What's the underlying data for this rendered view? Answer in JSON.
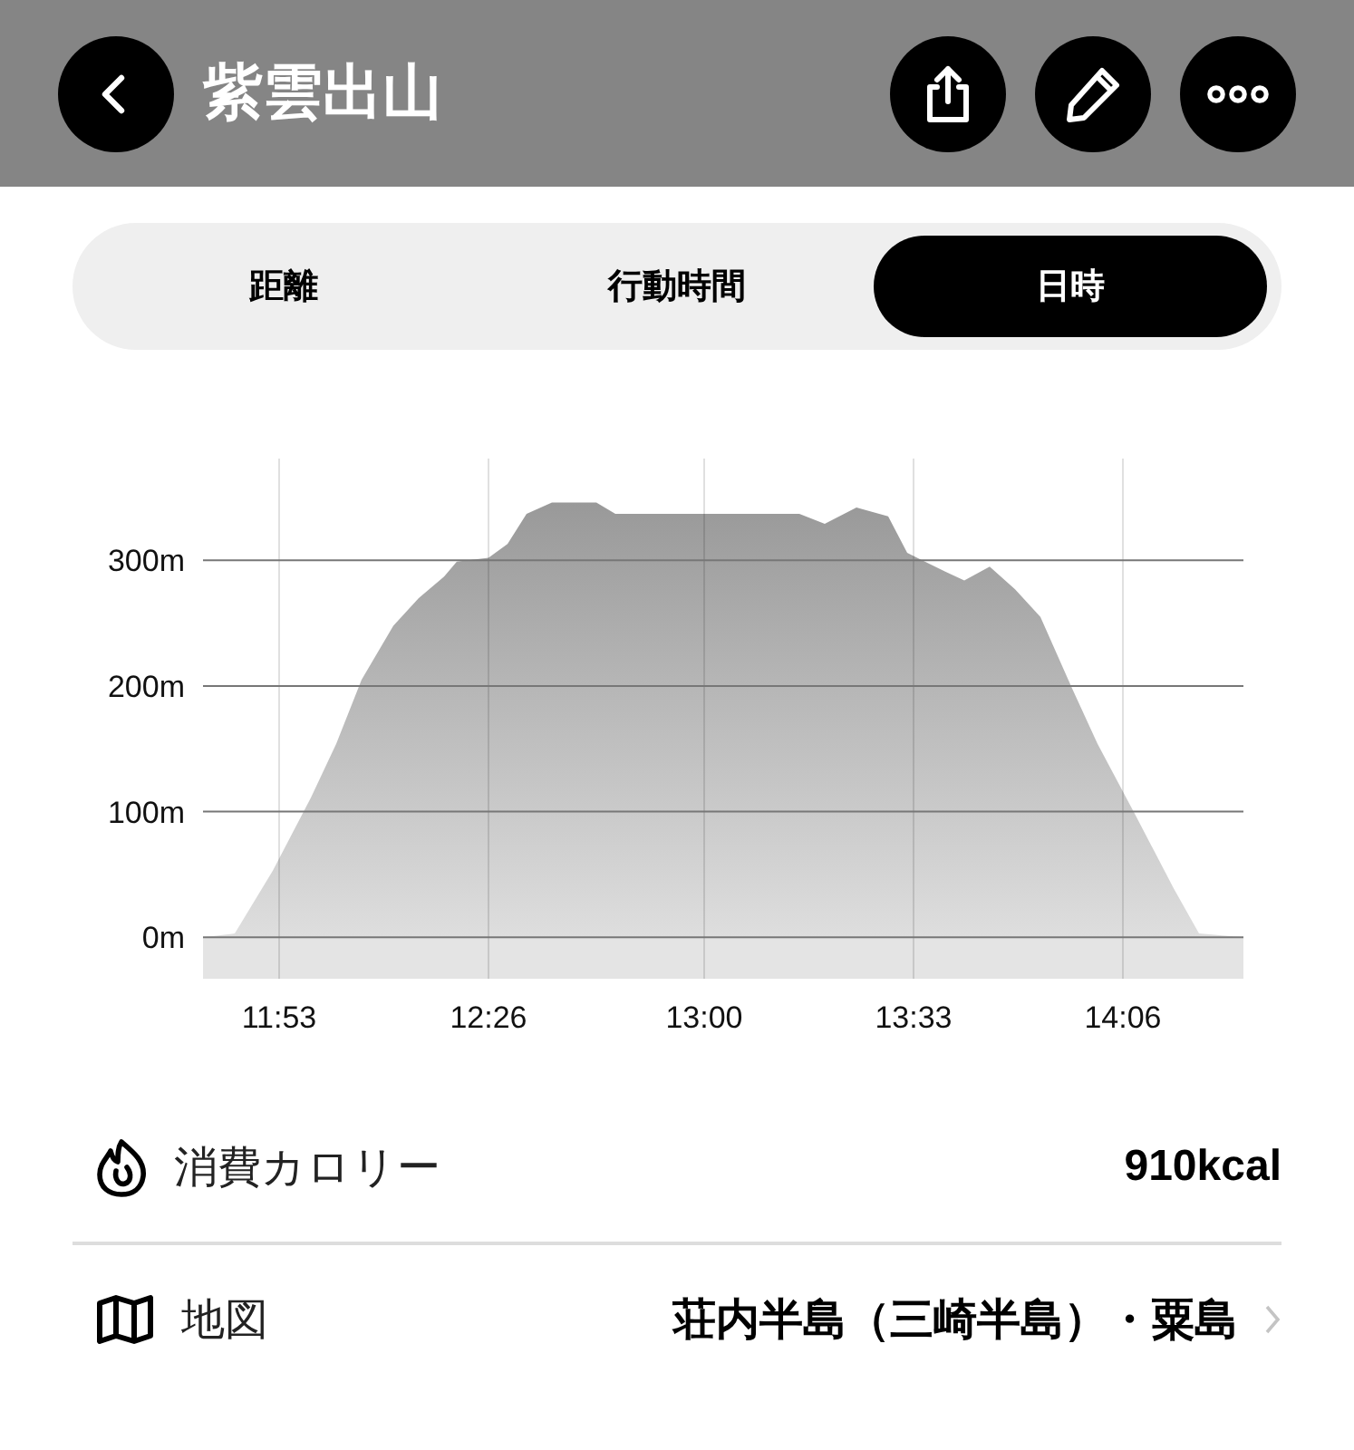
{
  "header": {
    "title": "紫雲出山"
  },
  "tabs": [
    {
      "label": "距離",
      "selected": false
    },
    {
      "label": "行動時間",
      "selected": false
    },
    {
      "label": "日時",
      "selected": true
    }
  ],
  "chart_data": {
    "type": "area",
    "xlim": [
      701,
      865
    ],
    "ylim": [
      -33,
      381
    ],
    "xticks": [
      {
        "value": 713,
        "label": "11:53"
      },
      {
        "value": 746,
        "label": "12:26"
      },
      {
        "value": 780,
        "label": "13:00"
      },
      {
        "value": 813,
        "label": "13:33"
      },
      {
        "value": 846,
        "label": "14:06"
      }
    ],
    "yticks": [
      {
        "value": 0,
        "label": "0m"
      },
      {
        "value": 100,
        "label": "100m"
      },
      {
        "value": 200,
        "label": "200m"
      },
      {
        "value": 300,
        "label": "300m"
      }
    ],
    "x": [
      701,
      706,
      712,
      718,
      722,
      726,
      731,
      735,
      739,
      741,
      746,
      749,
      752,
      756,
      763,
      766,
      779,
      795,
      799,
      804,
      809,
      812,
      818,
      821,
      825,
      829,
      833,
      838,
      842,
      848,
      854,
      858,
      865
    ],
    "grid": true,
    "series": [
      {
        "color": "#999999",
        "values": [
          0,
          3,
          53,
          111,
          154,
          205,
          248,
          270,
          287,
          299,
          302,
          313,
          337,
          346,
          346,
          337,
          337,
          337,
          329,
          342,
          335,
          306,
          291,
          284,
          295,
          277,
          255,
          198,
          154,
          97,
          39,
          3,
          0
        ]
      }
    ]
  },
  "stats": [
    {
      "kind": "calories",
      "label": "消費カロリー",
      "value": "910kcal",
      "link": false
    },
    {
      "kind": "map",
      "label": "地図",
      "value": "荘内半島（三崎半島）・粟島",
      "link": true
    }
  ]
}
